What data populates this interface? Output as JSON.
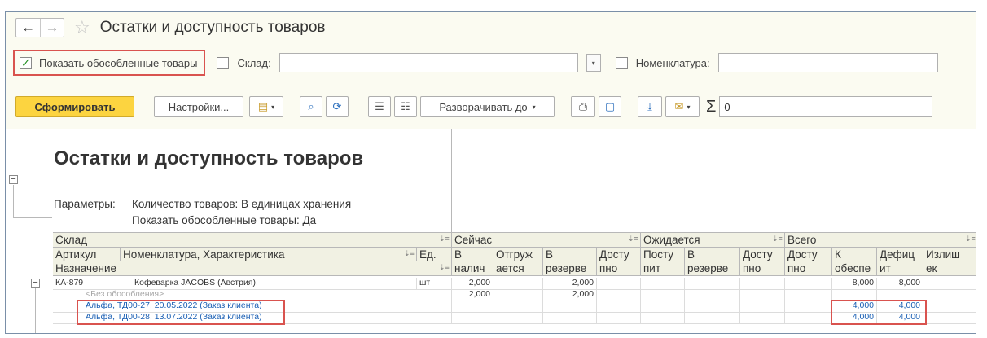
{
  "window": {
    "title": "Остатки и доступность товаров",
    "back_icon": "←",
    "forward_icon": "→",
    "star_icon": "☆"
  },
  "filters": {
    "show_isolated_label": "Показать обособленные товары",
    "show_isolated_checked": "✓",
    "warehouse_label": "Склад:",
    "warehouse_value": "",
    "nomenclature_label": "Номенклатура:",
    "nomenclature_value": ""
  },
  "toolbar": {
    "generate": "Сформировать",
    "settings": "Настройки...",
    "expand_to": "Разворачивать до",
    "sum_value": "0",
    "dropdown_glyph": "▾",
    "sigma": "Σ"
  },
  "report": {
    "title": "Остатки и доступность товаров",
    "params_label": "Параметры:",
    "param1": "Количество товаров: В единицах хранения",
    "param2": "Показать обособленные товары: Да",
    "headers": {
      "warehouse": "Склад",
      "article": "Артикул",
      "nomenclature": "Номенклатура, Характеристика",
      "unit": "Ед.",
      "purpose": "Назначение",
      "now": "Сейчас",
      "expected": "Ожидается",
      "total": "Всего",
      "in_stock_1": "В",
      "in_stock_2": "налич",
      "shipped_1": "Отгруж",
      "shipped_2": "ается",
      "reserve_1": "В",
      "reserve_2": "резерве",
      "avail_1": "Досту",
      "avail_2": "пно",
      "incoming_1": "Посту",
      "incoming_2": "пит",
      "exp_reserve_1": "В",
      "exp_reserve_2": "резерве",
      "exp_avail_1": "Досту",
      "exp_avail_2": "пно",
      "tot_avail_1": "Досту",
      "tot_avail_2": "пно",
      "to_provide_1": "К",
      "to_provide_2": "обеспе",
      "deficit_1": "Дефиц",
      "deficit_2": "ит",
      "surplus_1": "Излиш",
      "surplus_2": "ек"
    },
    "rows": [
      {
        "article": "КА-879",
        "name": "Кофеварка JACOBS (Австрия),",
        "unit": "шт",
        "in_stock": "2,000",
        "reserve": "2,000",
        "to_provide": "8,000",
        "deficit": "8,000"
      },
      {
        "purpose": "<Без обособления>",
        "in_stock": "2,000",
        "reserve": "2,000"
      },
      {
        "purpose": "Альфа, ТД00-27, 20.05.2022 (Заказ клиента)",
        "to_provide": "4,000",
        "deficit": "4,000"
      },
      {
        "purpose": "Альфа, ТД00-28, 13.07.2022 (Заказ клиента)",
        "to_provide": "4,000",
        "deficit": "4,000"
      }
    ]
  }
}
